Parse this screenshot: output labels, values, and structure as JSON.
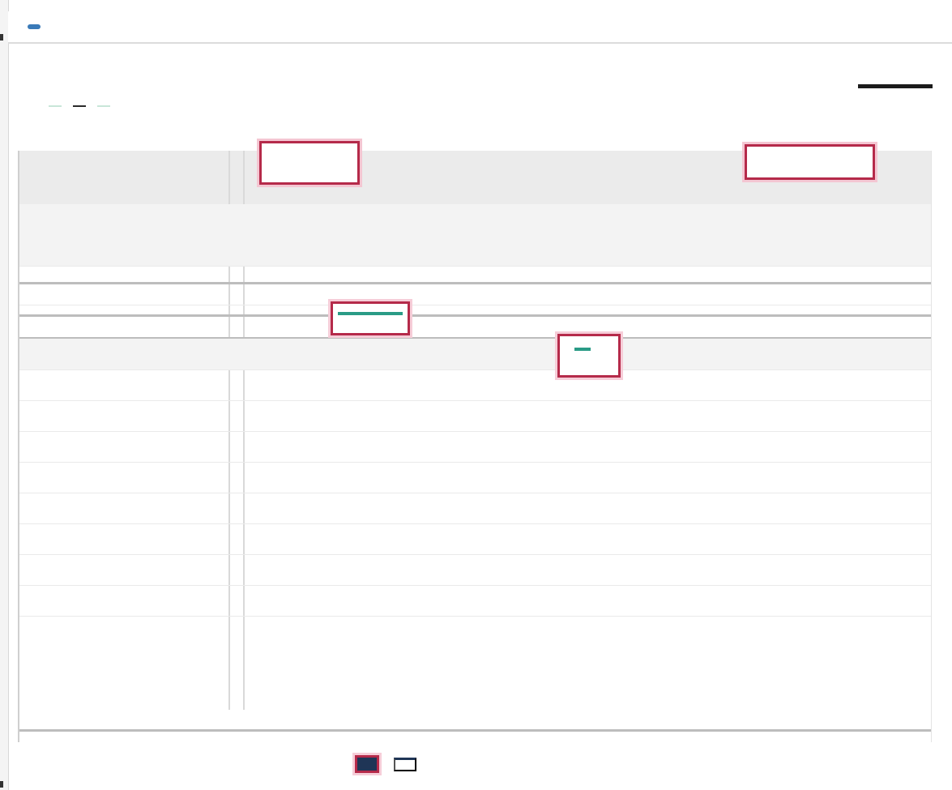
{
  "window": {
    "title": "",
    "badge": ""
  },
  "filters": [
    {
      "label": ""
    },
    {
      "label": ""
    },
    {
      "label": ""
    }
  ],
  "table": {
    "headers": [
      {
        "top": "",
        "bottom": ""
      },
      {
        "top": "",
        "bottom": ""
      },
      {
        "top": "",
        "bottom": ""
      },
      {
        "top": "",
        "bottom": ""
      }
    ],
    "rows": [
      [
        "",
        "",
        "",
        ""
      ],
      [
        "",
        "",
        "",
        ""
      ],
      [
        "",
        "",
        "",
        ""
      ],
      [
        "",
        "",
        "",
        ""
      ],
      [
        "",
        "",
        "",
        ""
      ],
      [
        "",
        "",
        "",
        ""
      ],
      [
        "",
        "",
        "",
        ""
      ],
      [
        "",
        "",
        "",
        ""
      ],
      [
        "",
        "",
        "",
        ""
      ],
      [
        "",
        "",
        "",
        ""
      ],
      [
        "",
        "",
        "",
        ""
      ],
      [
        "",
        "",
        "",
        ""
      ],
      [
        "",
        "",
        "",
        ""
      ],
      [
        "",
        "",
        "",
        ""
      ],
      [
        "",
        "",
        "",
        ""
      ],
      [
        "",
        "",
        "",
        ""
      ],
      [
        "",
        "",
        "",
        ""
      ]
    ]
  },
  "footer": {
    "primary_label": "",
    "secondary_label": ""
  },
  "colors": {
    "accent": "#b52a4a",
    "brand": "#1f3556",
    "teal": "#2a9b86"
  }
}
